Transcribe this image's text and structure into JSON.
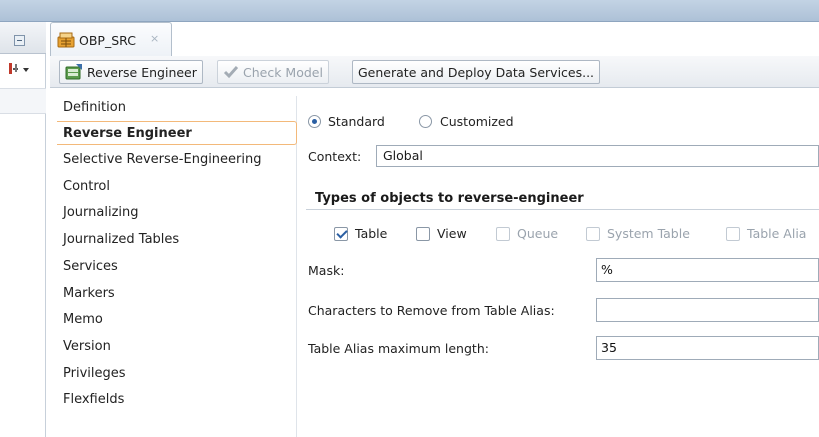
{
  "tab": {
    "title": "OBP_SRC",
    "close_glyph": "×"
  },
  "toolbar": {
    "reverse_engineer": "Reverse Engineer",
    "check_model": "Check Model",
    "generate_deploy": "Generate and Deploy Data Services..."
  },
  "nav": {
    "items": [
      "Definition",
      "Reverse Engineer",
      "Selective Reverse-Engineering",
      "Control",
      "Journalizing",
      "Journalized Tables",
      "Services",
      "Markers",
      "Memo",
      "Version",
      "Privileges",
      "Flexfields"
    ],
    "selected": "Reverse Engineer"
  },
  "form": {
    "mode": {
      "standard": "Standard",
      "customized": "Customized",
      "selected": "Standard"
    },
    "context_label": "Context:",
    "context_value": "Global",
    "types_title": "Types of objects to reverse-engineer",
    "types": {
      "table": {
        "label": "Table",
        "checked": true,
        "enabled": true
      },
      "view": {
        "label": "View",
        "checked": false,
        "enabled": true
      },
      "queue": {
        "label": "Queue",
        "checked": false,
        "enabled": false
      },
      "system_table": {
        "label": "System Table",
        "checked": false,
        "enabled": false
      },
      "table_alias": {
        "label": "Table Alia",
        "checked": false,
        "enabled": false
      }
    },
    "mask_label": "Mask:",
    "mask_value": "%",
    "chars_remove_label": "Characters to Remove from Table Alias:",
    "chars_remove_value": "",
    "alias_max_label": "Table Alias maximum length:",
    "alias_max_value": "35"
  },
  "icons": {
    "tab": "datastore-model-icon",
    "reverse": "reverse-engineer-icon",
    "check": "checkmark-icon",
    "collapse": "collapse-icon",
    "tool": "wand-dropdown-icon"
  },
  "colors": {
    "accent": "#2b5fa3",
    "selection_border": "#f3b97a",
    "top_bar": "#adc1d7"
  }
}
